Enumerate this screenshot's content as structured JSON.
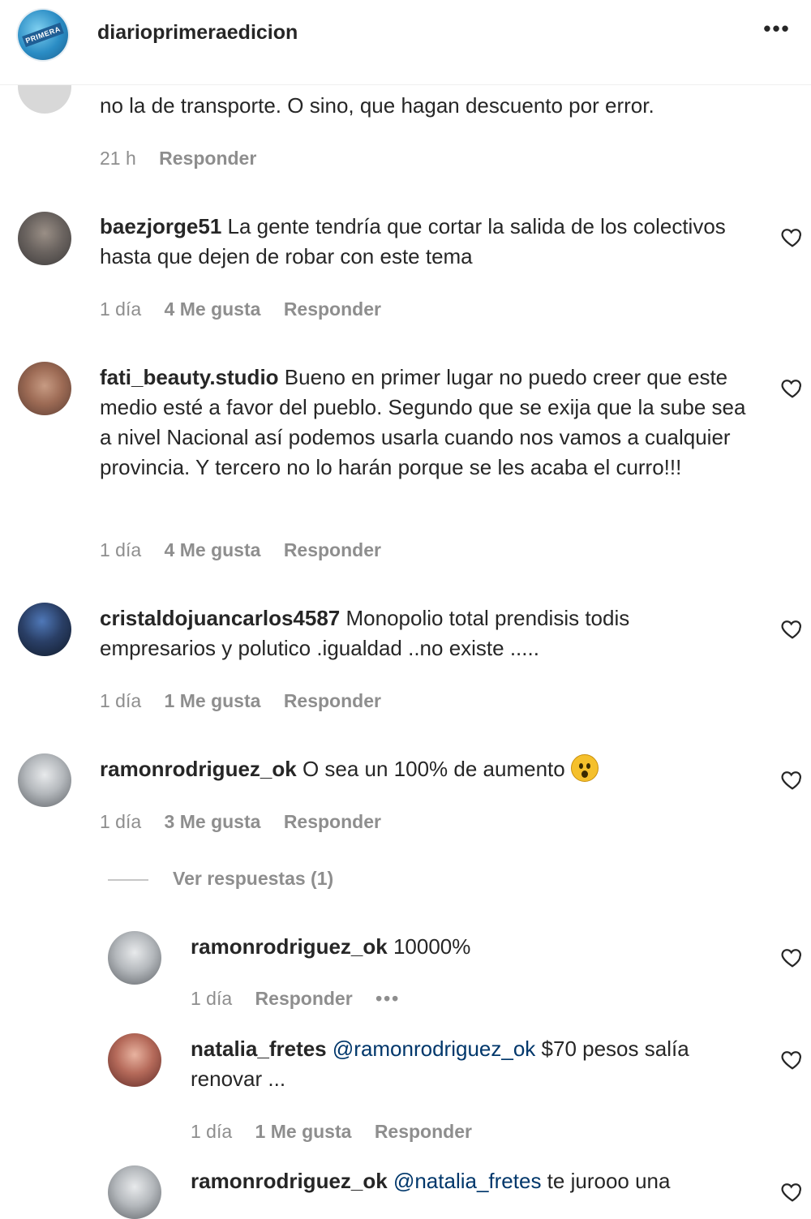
{
  "header": {
    "account": "diarioprimeraedicion",
    "more_label": "•••"
  },
  "comments": [
    {
      "text": "no la de transporte. O sino, que hagan descuento por error.",
      "time": "21 h",
      "reply": "Responder"
    },
    {
      "user": "baezjorge51",
      "text": " La gente tendría que cortar la salida de los colectivos hasta que dejen de robar con este tema",
      "time": "1 día",
      "likes": "4 Me gusta",
      "reply": "Responder"
    },
    {
      "user": "fati_beauty.studio",
      "text": " Bueno en primer lugar no puedo creer que este medio esté a favor del pueblo. Segundo que se exija que la sube sea a nivel Nacional así podemos usarla cuando nos vamos a cualquier provincia. Y tercero no lo harán porque se les acaba el curro!!!",
      "time": "1 día",
      "likes": "4 Me gusta",
      "reply": "Responder"
    },
    {
      "user": "cristaldojuancarlos4587",
      "text": " Monopolio total prendisis todis empresarios y polutico .igualdad ..no existe .....",
      "time": "1 día",
      "likes": "1 Me gusta",
      "reply": "Responder"
    },
    {
      "user": "ramonrodriguez_ok",
      "text": " O sea un 100% de aumento ",
      "time": "1 día",
      "likes": "3 Me gusta",
      "reply": "Responder",
      "view_replies": "Ver respuestas (1)"
    }
  ],
  "replies": [
    {
      "user": "ramonrodriguez_ok",
      "text": " 10000%",
      "time": "1 día",
      "reply": "Responder",
      "more": "•••"
    },
    {
      "user": "natalia_fretes",
      "mention": "@ramonrodriguez_ok",
      "text": " $70 pesos salía renovar ...",
      "time": "1 día",
      "likes": "1 Me gusta",
      "reply": "Responder"
    },
    {
      "user": "ramonrodriguez_ok",
      "mention": "@natalia_fretes",
      "text": " te jurooo una"
    }
  ],
  "colors": {
    "text": "#262626",
    "muted": "#8e8e8e",
    "mention": "#00376b"
  },
  "icons": [
    "heart-icon",
    "more-icon",
    "astonished-face-emoji"
  ]
}
